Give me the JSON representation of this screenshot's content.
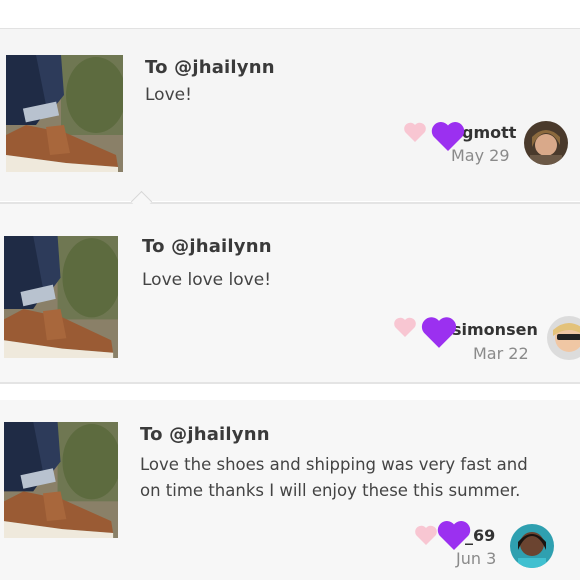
{
  "reviews": [
    {
      "to": "To @jhailynn",
      "message": "Love!",
      "username": "gmott",
      "date": "May 29"
    },
    {
      "to": "To @jhailynn",
      "message": "Love love love!",
      "username": "simonsen",
      "date": "Mar 22"
    },
    {
      "to": "To @jhailynn",
      "message_line1": "Love the shoes and shipping was very fast and",
      "message_line2": "on time thanks I will enjoy these this summer.",
      "username": "_69",
      "date": "Jun 3"
    }
  ],
  "icons": {
    "like": "pink-heart-icon",
    "badge": "purple-heart-icon"
  },
  "colors": {
    "purple_heart": "#9b30f0",
    "pink_heart": "#f8c6d2"
  }
}
